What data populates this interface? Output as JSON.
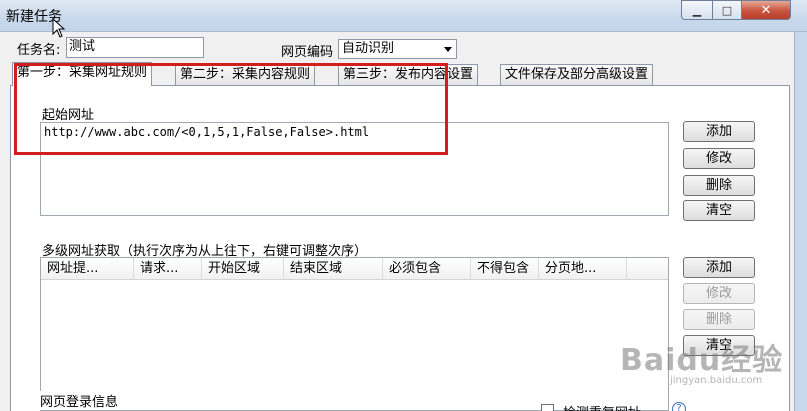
{
  "window": {
    "title": "新建任务",
    "minimize_glyph": "▁",
    "maximize_glyph": "□",
    "close_glyph": "✕"
  },
  "task": {
    "name_label": "任务名:",
    "name_value": "测试",
    "encoding_label": "网页编码",
    "encoding_value": "自动识别"
  },
  "tabs": [
    {
      "label": "第一步：采集网址规则",
      "active": true
    },
    {
      "label": "第二步：采集内容规则",
      "active": false
    },
    {
      "label": "第三步：发布内容设置",
      "active": false
    },
    {
      "label": "文件保存及部分高级设置",
      "active": false
    }
  ],
  "start_url": {
    "title": "起始网址",
    "value": "http://www.abc.com/<0,1,5,1,False,False>.html",
    "buttons": [
      "添加",
      "修改",
      "删除",
      "清空"
    ]
  },
  "multilevel": {
    "title": "多级网址获取（执行次序为从上往下，右键可调整次序）",
    "columns": [
      "网址提...",
      "请求...",
      "开始区域",
      "结束区域",
      "必须包含",
      "不得包含",
      "分页地..."
    ],
    "buttons": [
      {
        "label": "添加",
        "enabled": true
      },
      {
        "label": "修改",
        "enabled": false
      },
      {
        "label": "删除",
        "enabled": false
      },
      {
        "label": "清空",
        "enabled": true
      }
    ]
  },
  "login": {
    "title": "网页登录信息",
    "check_label": "检测重复网址"
  },
  "highlight_color": "#d21e1e",
  "watermark": {
    "logo": "Baidu经验",
    "sub": "jingyan.baidu.com"
  }
}
